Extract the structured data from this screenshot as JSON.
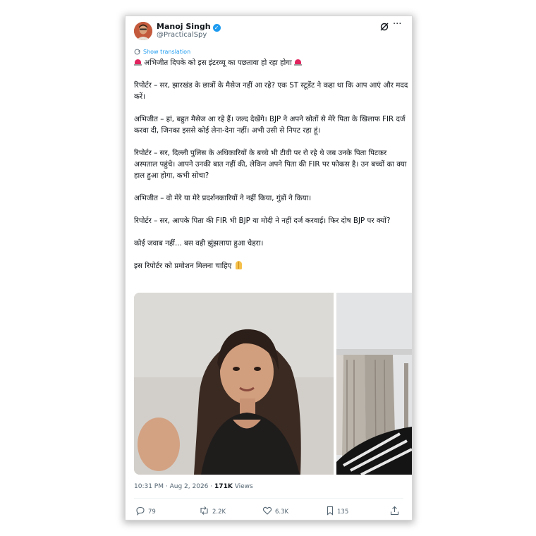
{
  "author": {
    "name": "Manoj Singh",
    "handle": "@PracticalSpy",
    "verified_color": "#1d9bf0"
  },
  "translate_label": "Show translation",
  "tweet": {
    "headline": "अभिजीत दिपके को इस इंटरव्यू का पछतावा हो रहा होगा",
    "paragraphs": [
      "रिपोर्टर – सर, झारखंड के छात्रों के मैसेज नहीं आ रहे? एक ST स्टूडेंट ने कहा था कि आप आएं और मदद करें।",
      "अभिजीत – हां, बहुत मैसेज आ रहे हैं। जल्द देखेंगे। BJP ने अपने स्रोतों से मेरे पिता के खिलाफ FIR दर्ज करवा दी, जिनका इससे कोई लेना-देना नहीं। अभी उसी से निपट रहा हूं।",
      "रिपोर्टर – सर, दिल्ली पुलिस के अधिकारियों के बच्चे भी टीवी पर रो रहे थे जब उनके पिता पिटकर अस्पताल पहुंचे। आपने उनकी बात नहीं की, लेकिन अपने पिता की FIR पर फोकस है। उन बच्चों का क्या हाल हुआ होगा, कभी सोचा?",
      "अभिजीत – वो मेरे या मेरे प्रदर्शनकारियों ने नहीं किया, गुंडों ने किया।",
      "रिपोर्टर – सर, आपके पिता की FIR भी BJP या मोदी ने नहीं दर्ज करवाई। फिर दोष BJP पर क्यों?",
      "कोई जवाब नहीं... बस वही झुंझलाया हुआ चेहरा।"
    ],
    "closing": "इस रिपोर्टर को प्रमोशन मिलना चाहिए"
  },
  "meta": {
    "time": "10:31 PM",
    "separator": "·",
    "date": "Aug 2, 2026",
    "views_count": "171K",
    "views_label": "Views"
  },
  "actions": {
    "replies": "79",
    "reposts": "2.2K",
    "likes": "6.3K",
    "bookmarks": "135"
  },
  "icons": [
    "verified-badge-icon",
    "grok-icon",
    "more-icon",
    "translate-icon",
    "siren-icon",
    "folded-hands-icon",
    "reply-icon",
    "repost-icon",
    "like-icon",
    "bookmark-icon",
    "share-icon"
  ],
  "colors": {
    "accent": "#1d9bf0",
    "text": "#0f1419",
    "secondary": "#536471",
    "siren": "#e0245e"
  }
}
